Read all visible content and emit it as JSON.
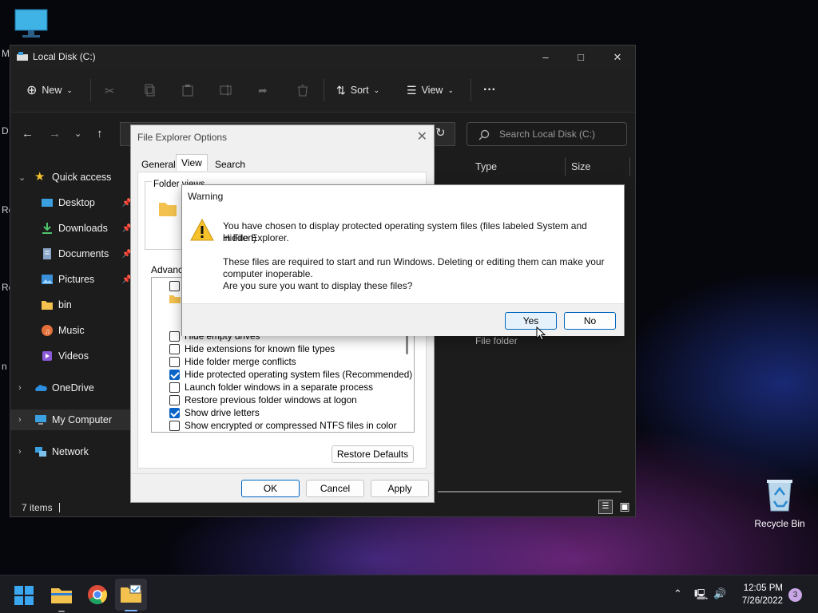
{
  "desktop": {
    "recycle_bin_label": "Recycle Bin",
    "edge_fragments": [
      "M",
      "D",
      "Re",
      "Re",
      "n"
    ]
  },
  "explorer": {
    "title": "Local Disk (C:)",
    "toolbar": {
      "new_label": "New",
      "sort_label": "Sort",
      "view_label": "View",
      "more_label": "···"
    },
    "search_placeholder": "Search Local Disk (C:)",
    "nav": {
      "quick_access": "Quick access",
      "items": [
        {
          "label": "Desktop",
          "icon": "desktop-icon"
        },
        {
          "label": "Downloads",
          "icon": "downloads-icon"
        },
        {
          "label": "Documents",
          "icon": "documents-icon"
        },
        {
          "label": "Pictures",
          "icon": "pictures-icon"
        },
        {
          "label": "bin",
          "icon": "folder-icon"
        },
        {
          "label": "Music",
          "icon": "music-icon"
        },
        {
          "label": "Videos",
          "icon": "videos-icon"
        }
      ],
      "onedrive": "OneDrive",
      "my_computer": "My Computer",
      "network": "Network"
    },
    "columns": {
      "type": "Type",
      "size": "Size"
    },
    "row_type": "File folder",
    "status": "7 items"
  },
  "options_dialog": {
    "title": "File Explorer Options",
    "tabs": [
      "General",
      "View",
      "Search"
    ],
    "active_tab": "View",
    "folder_views_label": "Folder views",
    "advanced_label": "Advanced settings:",
    "partial_row": "Hide empty drives",
    "settings": [
      {
        "label": "Hide extensions for known file types",
        "checked": false
      },
      {
        "label": "Hide folder merge conflicts",
        "checked": false
      },
      {
        "label": "Hide protected operating system files (Recommended)",
        "checked": true
      },
      {
        "label": "Launch folder windows in a separate process",
        "checked": false
      },
      {
        "label": "Restore previous folder windows at logon",
        "checked": false
      },
      {
        "label": "Show drive letters",
        "checked": true
      },
      {
        "label": "Show encrypted or compressed NTFS files in color",
        "checked": false
      }
    ],
    "restore_defaults": "Restore Defaults",
    "ok": "OK",
    "cancel": "Cancel",
    "apply": "Apply"
  },
  "warning_dialog": {
    "title": "Warning",
    "line1": "You have chosen to display protected operating system files (files labeled System and Hidden)",
    "line2": "in File Explorer.",
    "line3": "These files are required to start and run Windows. Deleting or editing them can make your",
    "line4": "computer inoperable.",
    "line5": "Are you sure you want to display these files?",
    "yes": "Yes",
    "no": "No"
  },
  "taskbar": {
    "time": "12:05 PM",
    "date": "7/26/2022",
    "notification_count": "3"
  }
}
